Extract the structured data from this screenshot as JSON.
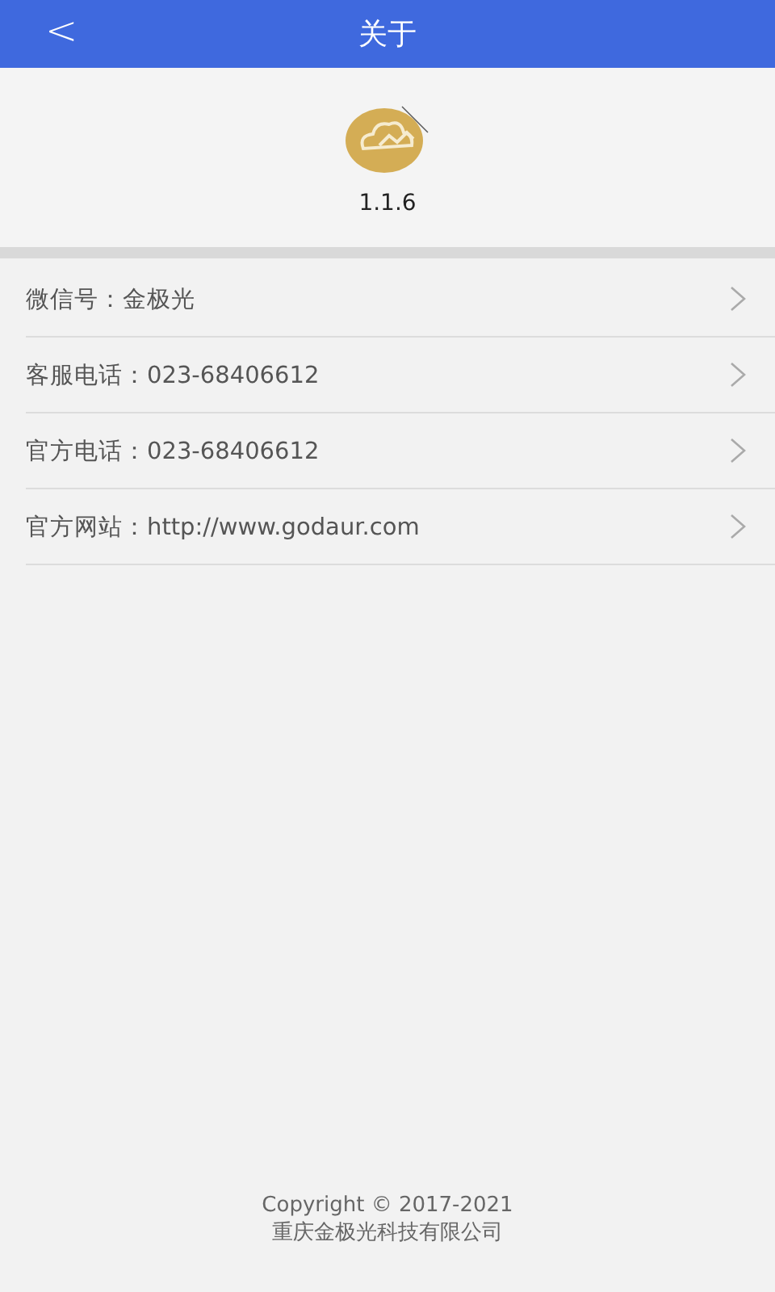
{
  "header": {
    "back": "<",
    "title": "关于"
  },
  "app": {
    "version": "1.1.6"
  },
  "items": [
    {
      "label": "微信号：金极光"
    },
    {
      "label": "客服电话：023-68406612"
    },
    {
      "label": "官方电话：023-68406612"
    },
    {
      "label": "官方网站：http://www.godaur.com"
    }
  ],
  "footer": {
    "copyright": "Copyright © 2017-2021",
    "company": "重庆金极光科技有限公司"
  }
}
